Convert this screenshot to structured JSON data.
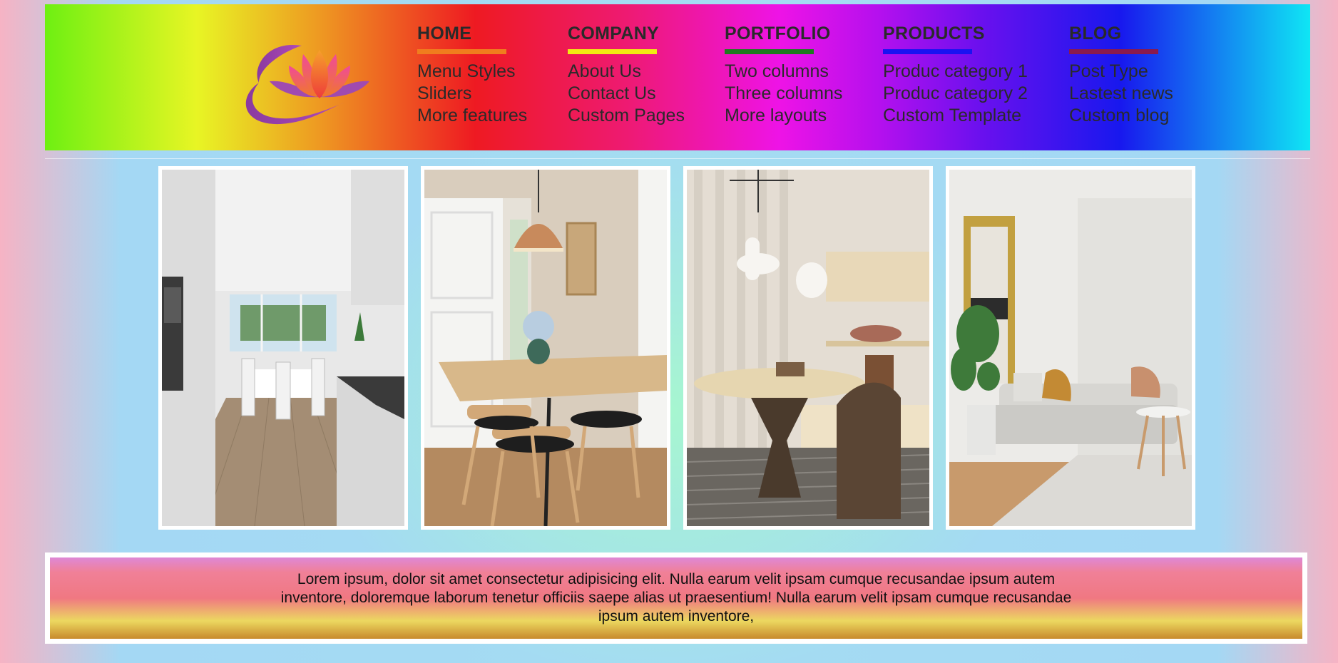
{
  "nav": [
    {
      "label": "HOME",
      "underline_color": "#f07d1e",
      "items": [
        "Menu Styles",
        "Sliders",
        "More features"
      ]
    },
    {
      "label": "COMPANY",
      "underline_color": "#f2ea12",
      "items": [
        "About Us",
        "Contact Us",
        "Custom Pages"
      ]
    },
    {
      "label": "PORTFOLIO",
      "underline_color": "#1f7a1f",
      "items": [
        "Two columns",
        "Three columns",
        "More layouts"
      ]
    },
    {
      "label": "PRODUCTS",
      "underline_color": "#1a12f2",
      "items": [
        "Produc category 1",
        "Produc category 2",
        "Custom Template"
      ]
    },
    {
      "label": "BLOG",
      "underline_color": "#8a1a4e",
      "items": [
        "Post Type",
        "Lastest news",
        "Custom blog"
      ]
    }
  ],
  "gallery": [
    {
      "name": "kitchen-photo"
    },
    {
      "name": "dining-room-photo"
    },
    {
      "name": "round-table-photo"
    },
    {
      "name": "living-room-photo"
    }
  ],
  "footer": {
    "text": "Lorem ipsum, dolor sit amet consectetur adipisicing elit. Nulla earum velit ipsam cumque recusandae ipsum autem inventore, doloremque laborum tenetur officiis saepe alias ut praesentium! Nulla earum velit ipsam cumque recusandae ipsum autem inventore,"
  },
  "colors": {
    "logo_petal": "#ee3b5e",
    "logo_swirl": "#8a3aa0"
  }
}
